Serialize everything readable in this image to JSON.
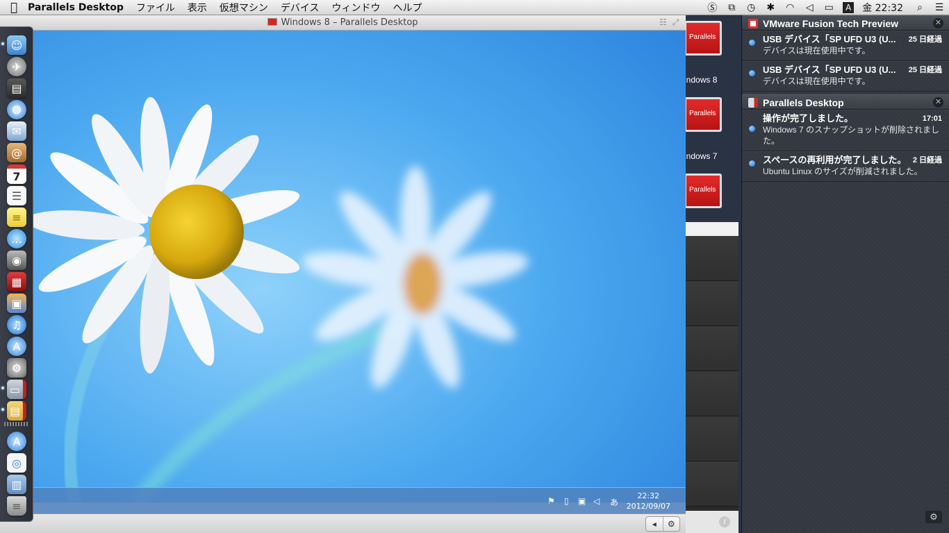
{
  "menubar": {
    "apple_icon": "apple-icon",
    "app_name": "Parallels Desktop",
    "menus": [
      "ファイル",
      "表示",
      "仮想マシン",
      "デバイス",
      "ウィンドウ",
      "ヘルプ"
    ],
    "clock": "金 22:32",
    "status_icons": [
      "script-icon",
      "parallels-icon",
      "time-machine-icon",
      "bluetooth-icon",
      "wifi-icon",
      "volume-icon",
      "battery-icon",
      "input-method-icon",
      "spotlight-icon",
      "notification-center-icon"
    ]
  },
  "vm_window": {
    "title": "Windows 8 – Parallels Desktop",
    "taskbar": {
      "time": "22:32",
      "date": "2012/09/07",
      "ime": "あ"
    }
  },
  "control_center": {
    "vms": [
      {
        "badge": "Parallels",
        "label": "indows 8"
      },
      {
        "badge": "Parallels",
        "label": "indows 7"
      },
      {
        "badge": "Parallels",
        "label": ""
      }
    ],
    "info_glyph": "i"
  },
  "notification_center": {
    "groups": [
      {
        "app": "VMware Fusion Tech Preview",
        "icon_color": "#e03030",
        "items": [
          {
            "title": "USB デバイス「SP UFD U3 (U...",
            "time": "25 日経過",
            "body": "デバイスは現在使用中です。"
          },
          {
            "title": "USB デバイス「SP UFD U3 (U...",
            "time": "25 日経過",
            "body": "デバイスは現在使用中です。"
          }
        ]
      },
      {
        "app": "Parallels Desktop",
        "icon_color": "#c42b2b",
        "items": [
          {
            "title": "操作が完了しました。",
            "time": "17:01",
            "body": "Windows 7 のスナップショットが削除されました。"
          },
          {
            "title": "スペースの再利用が完了しました。",
            "time": "2 日経過",
            "body": "Ubuntu Linux のサイズが削減されました。"
          }
        ]
      }
    ]
  },
  "dock": {
    "items": [
      "finder-icon",
      "launchpad-icon",
      "mission-control-icon",
      "safari-icon",
      "mail-stamp-icon",
      "contacts-icon",
      "calendar-icon",
      "reminders-icon",
      "notes-icon",
      "messages-icon",
      "facetime-icon",
      "photo-booth-icon",
      "iphoto-icon",
      "itunes-icon",
      "app-store-icon",
      "system-preferences-icon",
      "parallels-desktop-icon",
      "parallels-folder-icon",
      "applications-stack-icon",
      "documents-stack-icon",
      "downloads-stack-icon",
      "trash-icon"
    ],
    "calendar_day": "7"
  },
  "colors": {
    "accent": "#2d84e0",
    "parallels_red": "#d62525"
  }
}
